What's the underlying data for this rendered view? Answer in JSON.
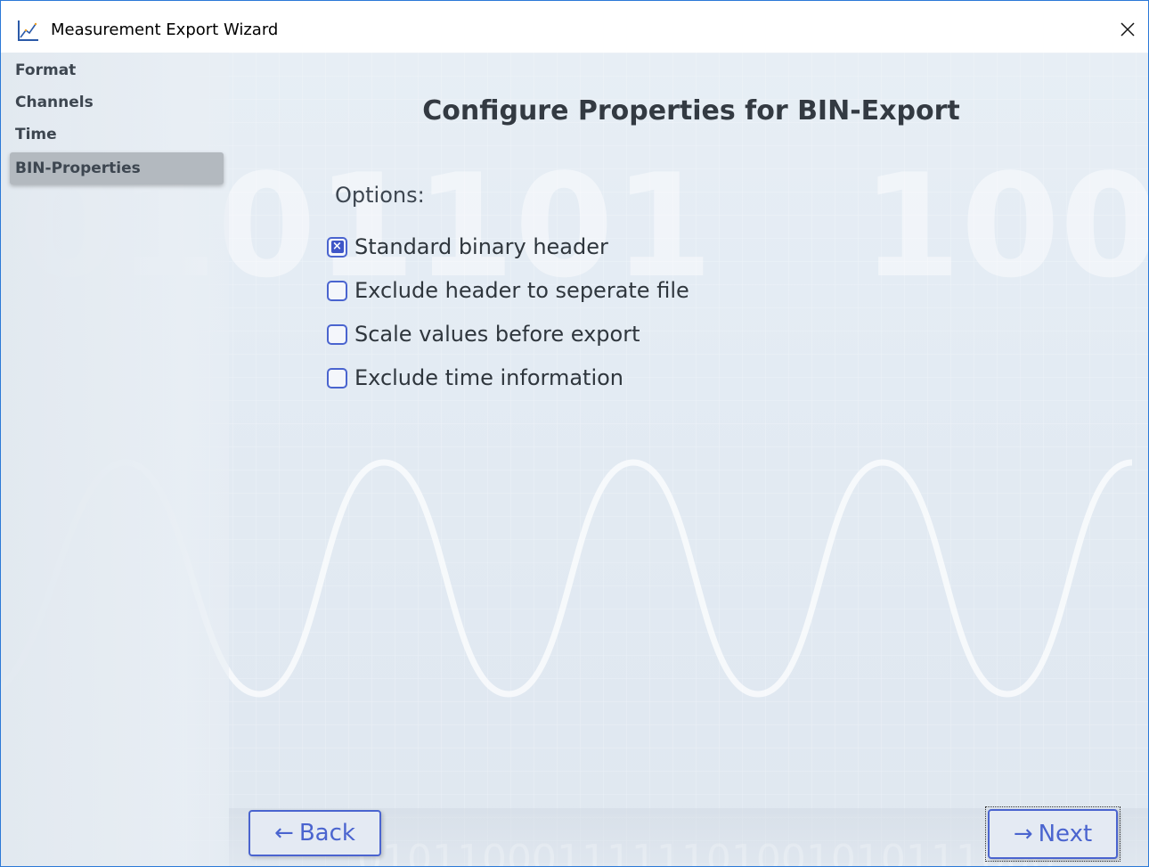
{
  "window": {
    "title": "Measurement Export Wizard",
    "close_glyph": "✕",
    "icon": "chart-icon"
  },
  "sidebar": {
    "items": [
      {
        "label": "Format",
        "active": false
      },
      {
        "label": "Channels",
        "active": false
      },
      {
        "label": "Time",
        "active": false
      },
      {
        "label": "BIN-Properties",
        "active": true
      }
    ]
  },
  "main": {
    "heading": "Configure Properties for BIN-Export",
    "options_label": "Options:",
    "options": [
      {
        "label": "Standard binary header",
        "checked": true
      },
      {
        "label": "Exclude header to seperate file",
        "checked": false
      },
      {
        "label": "Scale values before export",
        "checked": false
      },
      {
        "label": "Exclude time information",
        "checked": false
      }
    ]
  },
  "footer": {
    "back_label": "Back",
    "back_arrow": "←",
    "next_label": "Next",
    "next_arrow": "→"
  },
  "colors": {
    "accent": "#4a64cf",
    "background": "#e3ebf3",
    "active_nav": "#b3b9bf"
  }
}
